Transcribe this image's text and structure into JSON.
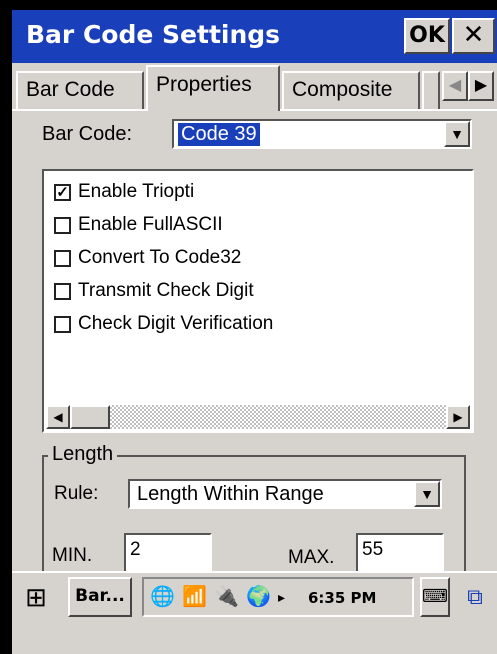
{
  "window": {
    "title": "Bar Code Settings",
    "ok_label": "OK",
    "close_label": "✕"
  },
  "tabs": [
    {
      "label": "Bar Code",
      "active": false
    },
    {
      "label": "Properties",
      "active": true
    },
    {
      "label": "Composite",
      "active": false
    }
  ],
  "tab_scroll": {
    "left": "◀",
    "right": "▶"
  },
  "barcode": {
    "label": "Bar Code:",
    "selected": "Code 39",
    "dropdown_icon": "▼"
  },
  "options": [
    {
      "label": "Enable Triopti",
      "checked": true,
      "mark": "✓"
    },
    {
      "label": "Enable FullASCII",
      "checked": false,
      "mark": ""
    },
    {
      "label": "Convert To Code32",
      "checked": false,
      "mark": ""
    },
    {
      "label": "Transmit Check Digit",
      "checked": false,
      "mark": ""
    },
    {
      "label": "Check Digit Verification",
      "checked": false,
      "mark": ""
    }
  ],
  "hscroll": {
    "left": "◀",
    "right": "▶"
  },
  "length": {
    "group_title": "Length",
    "rule_label": "Rule:",
    "rule_value": "Length Within Range",
    "dropdown_icon": "▼",
    "min_label": "MIN.",
    "min_value": "2",
    "max_label": "MAX.",
    "max_value": "55"
  },
  "taskbar": {
    "start_icon": "⊞",
    "app_button": "Bar...",
    "tray_icons": [
      "🌐",
      "📶",
      "🔌",
      "🌍",
      "▸"
    ],
    "clock": "6:35 PM",
    "keyboard_icon": "⌨",
    "windows_icon": "⧉"
  }
}
